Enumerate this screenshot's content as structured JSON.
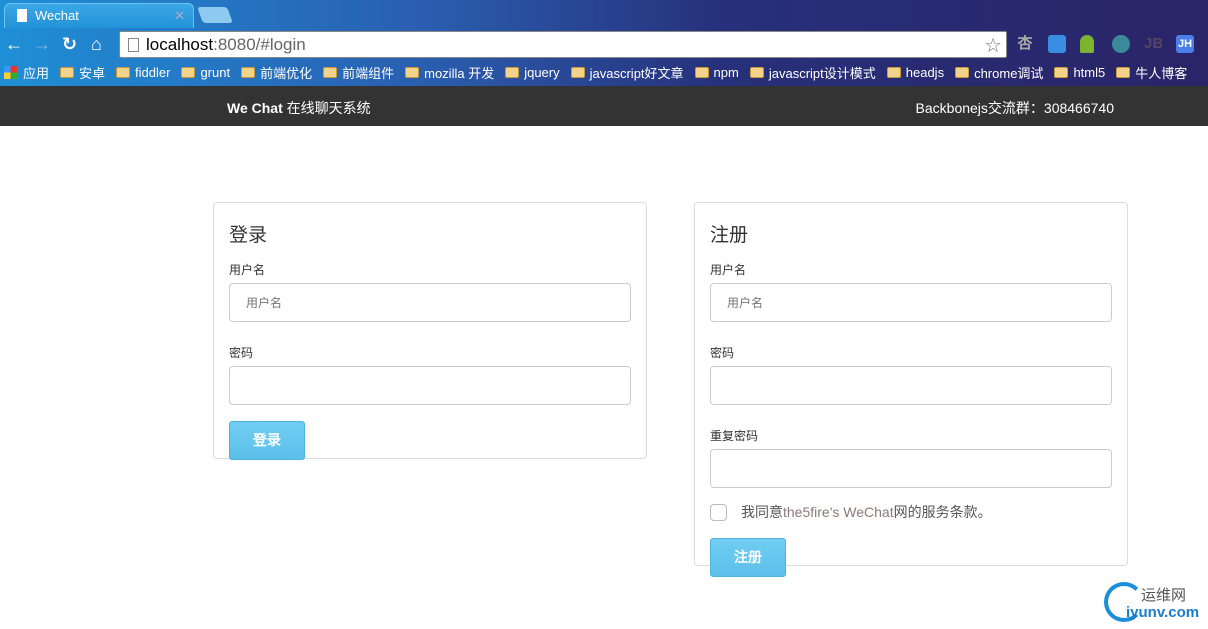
{
  "browser": {
    "tab_title": "Wechat",
    "url_host": "localhost",
    "url_rest": ":8080/#login",
    "extensions": [
      "杏",
      "chart-ext",
      "android-ext",
      "swirl-ext",
      "JB",
      "JH"
    ],
    "bookmarks": [
      "应用",
      "安卓",
      "fiddler",
      "grunt",
      "前端优化",
      "前端组件",
      "mozilla 开发",
      "jquery",
      "javascript好文章",
      "npm",
      "javascript设计模式",
      "headjs",
      "chrome调试",
      "html5",
      "牛人博客"
    ]
  },
  "navbar": {
    "brand_bold": "We Chat",
    "brand_rest": " 在线聊天系统",
    "qq_group": "Backbonejs交流群：308466740"
  },
  "login": {
    "title": "登录",
    "username_label": "用户名",
    "username_placeholder": "用户名",
    "password_label": "密码",
    "submit": "登录"
  },
  "register": {
    "title": "注册",
    "username_label": "用户名",
    "username_placeholder": "用户名",
    "password_label": "密码",
    "repeat_label": "重复密码",
    "agree_pre": "我同意",
    "agree_name": "the5fire's WeChat",
    "agree_post": "网的服务条款。",
    "submit": "注册"
  },
  "watermark": {
    "cn": "运维网",
    "en": "iyunv.com"
  },
  "colors": {
    "navbar": "#333333",
    "button": "#5bc0ea"
  }
}
